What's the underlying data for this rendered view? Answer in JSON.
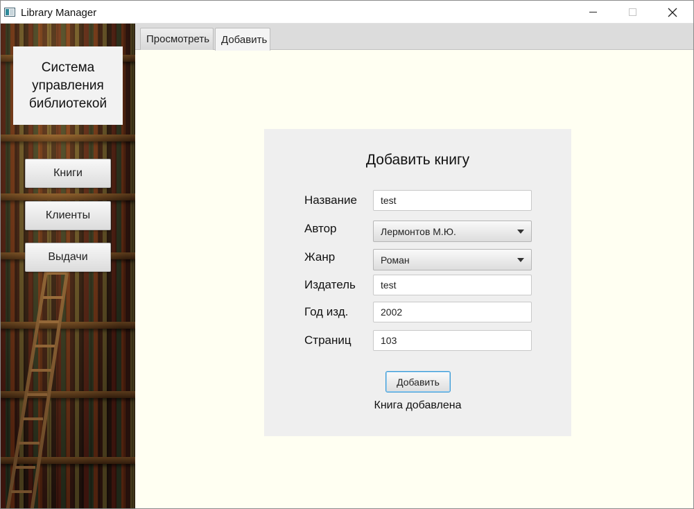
{
  "window": {
    "title": "Library Manager",
    "controls": {
      "minimize": "minimize-icon",
      "maximize": "maximize-icon",
      "close": "close-icon"
    }
  },
  "sidebar": {
    "logo_text": "Система управления библиотекой",
    "buttons": [
      {
        "label": "Книги"
      },
      {
        "label": "Клиенты"
      },
      {
        "label": "Выдачи"
      }
    ]
  },
  "tabs": [
    {
      "label": "Просмотреть",
      "selected": false
    },
    {
      "label": "Добавить",
      "selected": true
    }
  ],
  "form": {
    "title": "Добавить книгу",
    "fields": {
      "name": {
        "label": "Название",
        "value": "test"
      },
      "author": {
        "label": "Автор",
        "value": "Лермонтов М.Ю."
      },
      "genre": {
        "label": "Жанр",
        "value": "Роман"
      },
      "publisher": {
        "label": "Издатель",
        "value": "test"
      },
      "year": {
        "label": "Год изд.",
        "value": "2002"
      },
      "pages": {
        "label": "Страниц",
        "value": "103"
      }
    },
    "submit_label": "Добавить",
    "status": "Книга добавлена"
  },
  "colors": {
    "content_bg": "#fffff2",
    "card_bg": "#efefef",
    "focus_border": "#3c9bd6"
  }
}
